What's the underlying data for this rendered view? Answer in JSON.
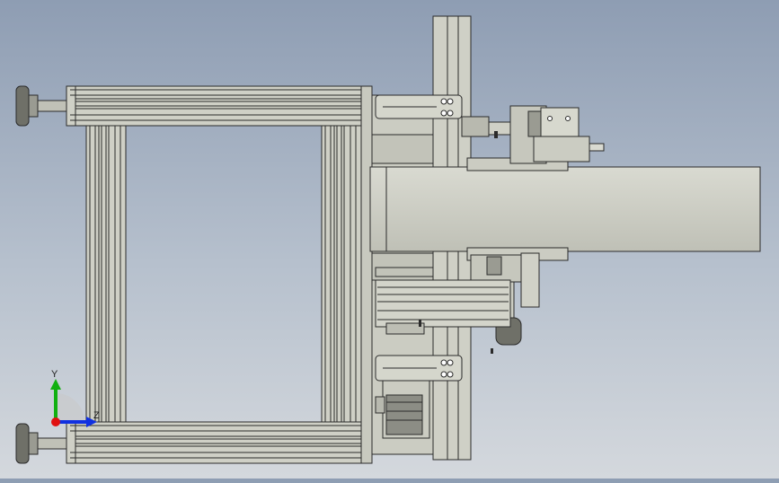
{
  "viewport": {
    "background_top": "#8e9db3",
    "background_bottom": "#d4d8dd",
    "model_fill": "#cfd0c6",
    "model_stroke": "#2b2b2b",
    "profile_dark": "#6f7068",
    "shadow": "#7e7f77"
  },
  "triad": {
    "y_label": "Y",
    "z_label": "Z",
    "y_color": "#10b010",
    "z_color": "#1030e0",
    "x_color": "#e01010"
  }
}
